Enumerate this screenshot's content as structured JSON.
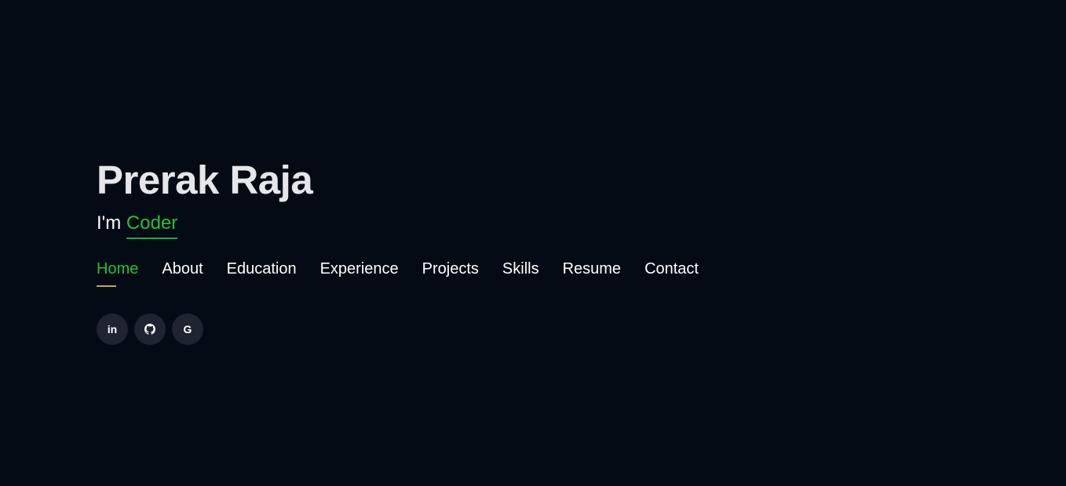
{
  "hero": {
    "name": "Prerak Raja",
    "tagline_prefix": "I'm",
    "tagline_typed": "Coder"
  },
  "nav": {
    "items": [
      {
        "label": "Home",
        "active": true
      },
      {
        "label": "About",
        "active": false
      },
      {
        "label": "Education",
        "active": false
      },
      {
        "label": "Experience",
        "active": false
      },
      {
        "label": "Projects",
        "active": false
      },
      {
        "label": "Skills",
        "active": false
      },
      {
        "label": "Resume",
        "active": false
      },
      {
        "label": "Contact",
        "active": false
      }
    ]
  },
  "social": {
    "links": [
      {
        "icon": "linkedin-icon",
        "glyph": "in"
      },
      {
        "icon": "github-icon",
        "glyph": ""
      },
      {
        "icon": "google-icon",
        "glyph": "G"
      }
    ]
  },
  "colors": {
    "background": "#040b14",
    "accent": "#22c13f",
    "active_underline": "#c9a24b",
    "social_bg": "#1f2530"
  }
}
